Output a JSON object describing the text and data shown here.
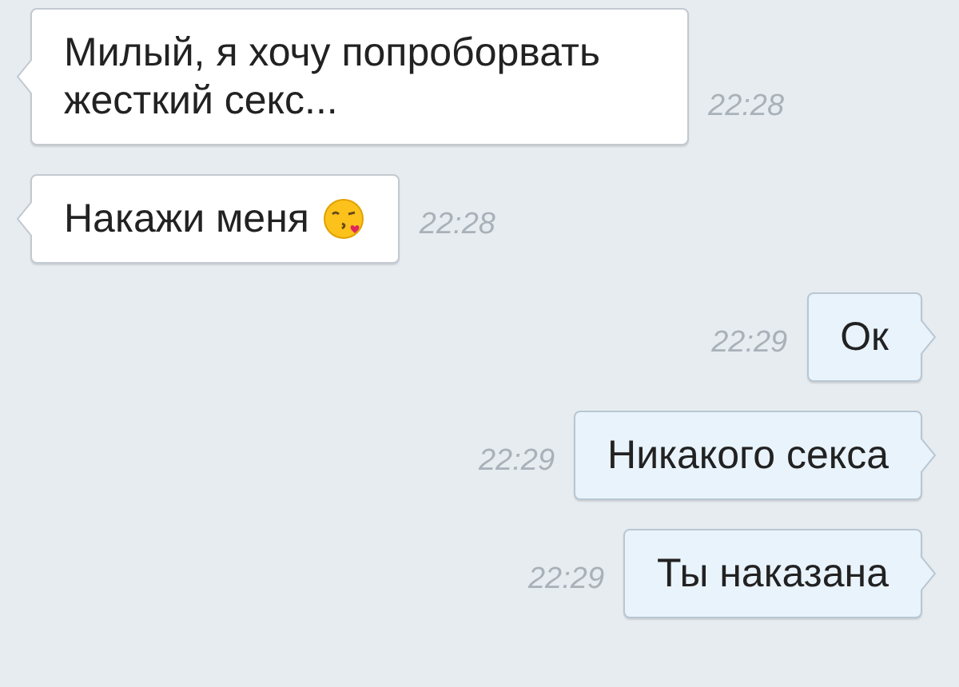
{
  "messages": [
    {
      "kind": "incoming",
      "text": "Милый, я хочу попроборвать жесткий секс...",
      "time": "22:28",
      "emoji": false
    },
    {
      "kind": "incoming",
      "text": "Накажи меня",
      "time": "22:28",
      "emoji": true
    },
    {
      "kind": "outgoing",
      "text": "Ок",
      "time": "22:29",
      "emoji": false
    },
    {
      "kind": "outgoing",
      "text": "Никакого секса",
      "time": "22:29",
      "emoji": false
    },
    {
      "kind": "outgoing",
      "text": "Ты наказана",
      "time": "22:29",
      "emoji": false
    }
  ]
}
